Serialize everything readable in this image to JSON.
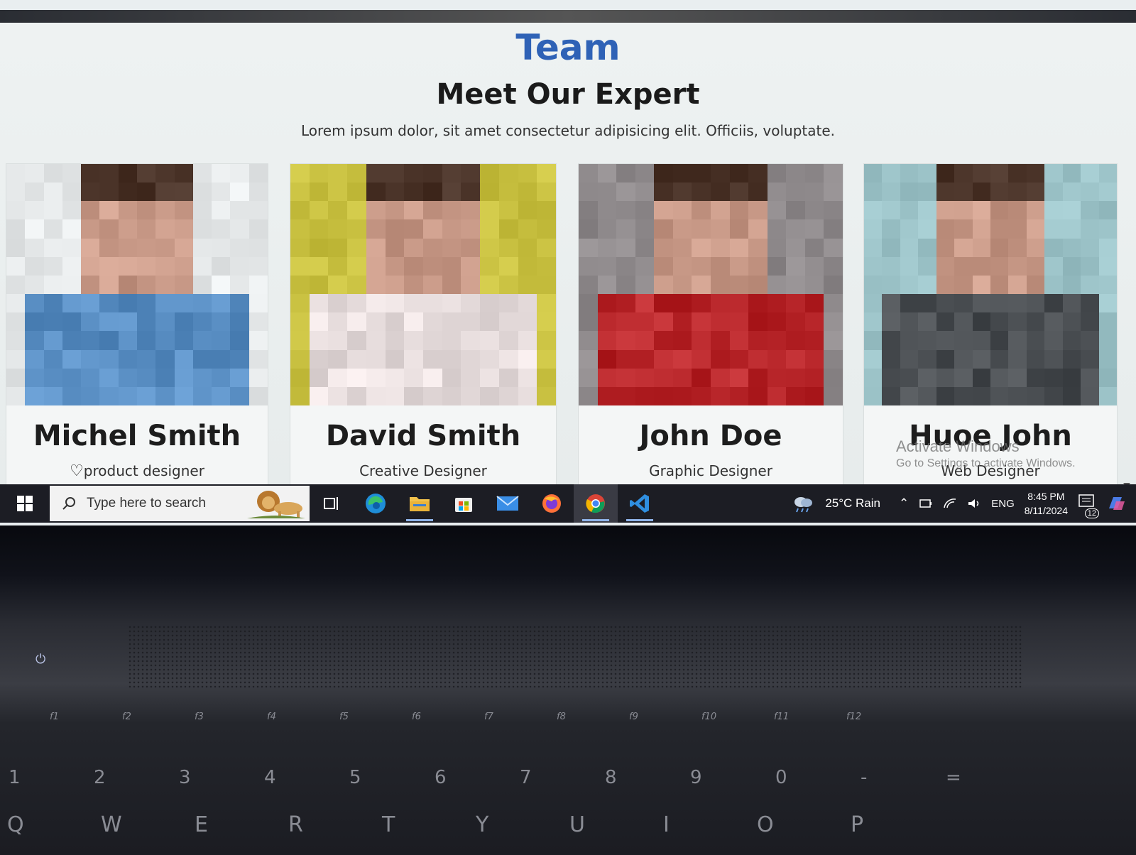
{
  "header": {
    "section_label": "Team",
    "title": "Meet Our Expert",
    "subtitle": "Lorem ipsum dolor, sit amet consectetur adipisicing elit. Officiis, voluptate."
  },
  "team": [
    {
      "name": "Michel Smith",
      "role": "product designer",
      "photo_tone": "#5a8fc4",
      "bg_tone": "#e6e9ea"
    },
    {
      "name": "David Smith",
      "role": "Creative Designer",
      "photo_tone": "#e8dede",
      "bg_tone": "#c8c040"
    },
    {
      "name": "John Doe",
      "role": "Graphic Designer",
      "photo_tone": "#b8262a",
      "bg_tone": "#8f8a8c"
    },
    {
      "name": "Huoe John",
      "role": "Web Designer",
      "photo_tone": "#4a4e52",
      "bg_tone": "#9cc3c8"
    }
  ],
  "watermark": {
    "line1": "Activate Windows",
    "line2": "Go to Settings to activate Windows."
  },
  "taskbar": {
    "search_placeholder": "Type here to search",
    "weather": "25°C  Rain",
    "language": "ENG",
    "time": "8:45 PM",
    "date": "8/11/2024",
    "notifications": "12",
    "apps": [
      "task-view",
      "edge",
      "file-explorer",
      "microsoft-store",
      "mail",
      "firefox",
      "chrome",
      "vscode"
    ]
  },
  "keyboard": {
    "fn_row": [
      "f1",
      "f2",
      "f3",
      "f4",
      "f5",
      "f6",
      "f7",
      "f8",
      "f9",
      "f10",
      "f11",
      "f12"
    ],
    "num_row": [
      "1",
      "2",
      "3",
      "4",
      "5",
      "6",
      "7",
      "8",
      "9",
      "0",
      "-",
      "="
    ],
    "letter_row": [
      "Q",
      "W",
      "E",
      "R",
      "T",
      "Y",
      "U",
      "I",
      "O",
      "P"
    ]
  }
}
